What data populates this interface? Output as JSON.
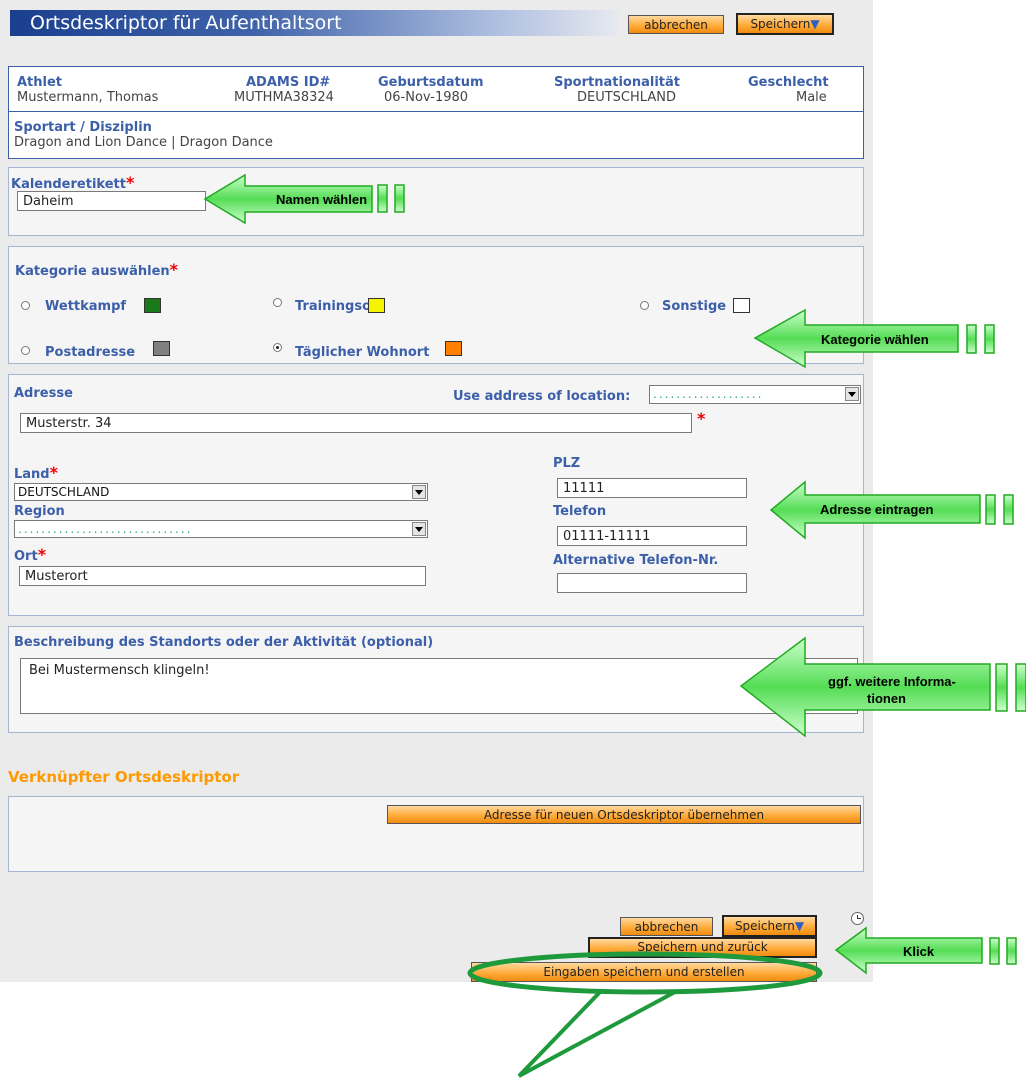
{
  "window": {
    "title": "Ortsdeskriptor für Aufenthaltsort"
  },
  "toolbar": {
    "cancel_label": "abbrechen",
    "save_label": "Speichern"
  },
  "athlete": {
    "athlet_label": "Athlet",
    "athlet_value": "Mustermann, Thomas",
    "adams_label": "ADAMS ID#",
    "adams_value": "MUTHMA38324",
    "birth_label": "Geburtsdatum",
    "birth_value": "06-Nov-1980",
    "nation_label": "Sportnationalität",
    "nation_value": "DEUTSCHLAND",
    "gender_label": "Geschlecht",
    "gender_value": "Male",
    "sport_label": "Sportart / Disziplin",
    "sport_value": "Dragon and Lion Dance | Dragon Dance"
  },
  "calendar": {
    "label": "Kalenderetikett",
    "required": "*",
    "value": "Daheim"
  },
  "category": {
    "label": "Kategorie auswählen",
    "required": "*",
    "options": [
      {
        "label": "Wettkampf",
        "color": "#1a7a1a",
        "selected": false
      },
      {
        "label": "Trainingsort",
        "color": "#f5f500",
        "selected": false
      },
      {
        "label": "Sonstige",
        "color": "#ffffff",
        "selected": false
      },
      {
        "label": "Postadresse",
        "color": "#808080",
        "selected": false
      },
      {
        "label": "Täglicher Wohnort",
        "color": "#ff7f00",
        "selected": true
      }
    ]
  },
  "address": {
    "label": "Adresse",
    "use_address_label": "Use address of location:",
    "use_address_value": "...................",
    "street_value": "Musterstr. 34",
    "required": "*",
    "country_label": "Land",
    "country_value": "DEUTSCHLAND",
    "region_label": "Region",
    "region_value": "..............................",
    "city_label": "Ort",
    "city_value": "Musterort",
    "zip_label": "PLZ",
    "zip_value": "11111",
    "phone_label": "Telefon",
    "phone_value": "01111-11111",
    "alt_phone_label": "Alternative Telefon-Nr.",
    "alt_phone_value": ""
  },
  "description": {
    "label": "Beschreibung des Standorts oder der Aktivität (optional)",
    "value": "Bei Mustermensch klingeln!"
  },
  "linked": {
    "title": "Verknüpfter Ortsdeskriptor",
    "button_label": "Adresse für neuen Ortsdeskriptor übernehmen"
  },
  "footer": {
    "cancel_label": "abbrechen",
    "save_label": "Speichern",
    "save_back_label": "Speichern und zurück",
    "save_create_label": "Eingaben speichern und erstellen"
  },
  "callouts": {
    "name": "Namen wählen",
    "category": "Kategorie wählen",
    "address": "Adresse eintragen",
    "info_line1": "ggf. weitere Informa-",
    "info_line2": "tionen",
    "click": "Klick"
  },
  "colors": {
    "accent_orange": "#ff9900",
    "label_blue": "#3c5faa",
    "callout_green": "#33cc33"
  }
}
